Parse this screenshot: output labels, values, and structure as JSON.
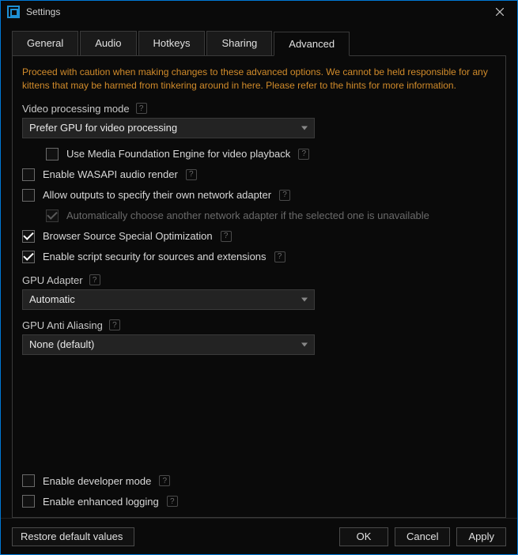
{
  "window": {
    "title": "Settings"
  },
  "tabs": {
    "general": "General",
    "audio": "Audio",
    "hotkeys": "Hotkeys",
    "sharing": "Sharing",
    "advanced": "Advanced"
  },
  "advanced": {
    "warning": "Proceed with caution when making changes to these advanced options. We cannot be held responsible for any kittens that may be harmed from tinkering around in here. Please refer to the hints for more information.",
    "video_mode_label": "Video processing mode",
    "video_mode_value": "Prefer GPU for video processing",
    "use_mf_label": "Use Media Foundation Engine for video playback",
    "wasapi_label": "Enable WASAPI audio render",
    "allow_adapter_label": "Allow outputs to specify their own network adapter",
    "auto_adapter_label": "Automatically choose another network adapter if the selected one is unavailable",
    "browser_opt_label": "Browser Source Special Optimization",
    "script_sec_label": "Enable script security for sources and extensions",
    "gpu_adapter_label": "GPU Adapter",
    "gpu_adapter_value": "Automatic",
    "gpu_aa_label": "GPU Anti Aliasing",
    "gpu_aa_value": "None (default)",
    "dev_mode_label": "Enable developer mode",
    "enh_log_label": "Enable enhanced logging"
  },
  "footer": {
    "restore": "Restore default values",
    "ok": "OK",
    "cancel": "Cancel",
    "apply": "Apply"
  },
  "help_glyph": "?"
}
